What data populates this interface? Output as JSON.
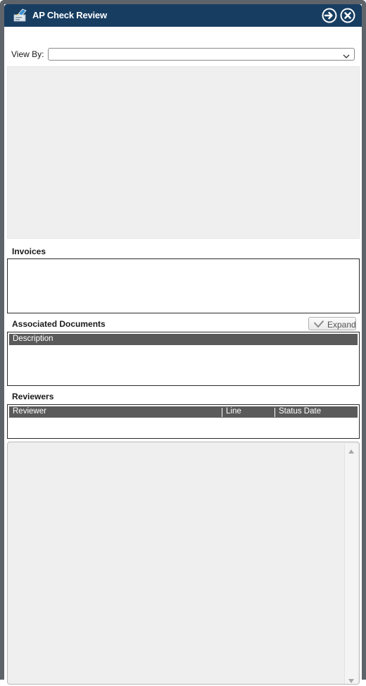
{
  "window": {
    "title": "AP Check Review",
    "icons": {
      "app": "check-review-app-icon",
      "next": "arrow-right-circle-icon",
      "close": "close-circle-icon"
    },
    "colors": {
      "titlebar": "#173d61",
      "frame": "#5f646b",
      "grid_header": "#5a5a5a",
      "panel": "#efefef"
    }
  },
  "filter": {
    "label": "View By:",
    "value": ""
  },
  "invoices": {
    "label": "Invoices"
  },
  "associated_documents": {
    "label": "Associated Documents",
    "expand_label": "Expand",
    "columns": [
      "Description"
    ]
  },
  "reviewers": {
    "label": "Reviewers",
    "columns": [
      "Reviewer",
      "Line",
      "Status Date"
    ]
  }
}
